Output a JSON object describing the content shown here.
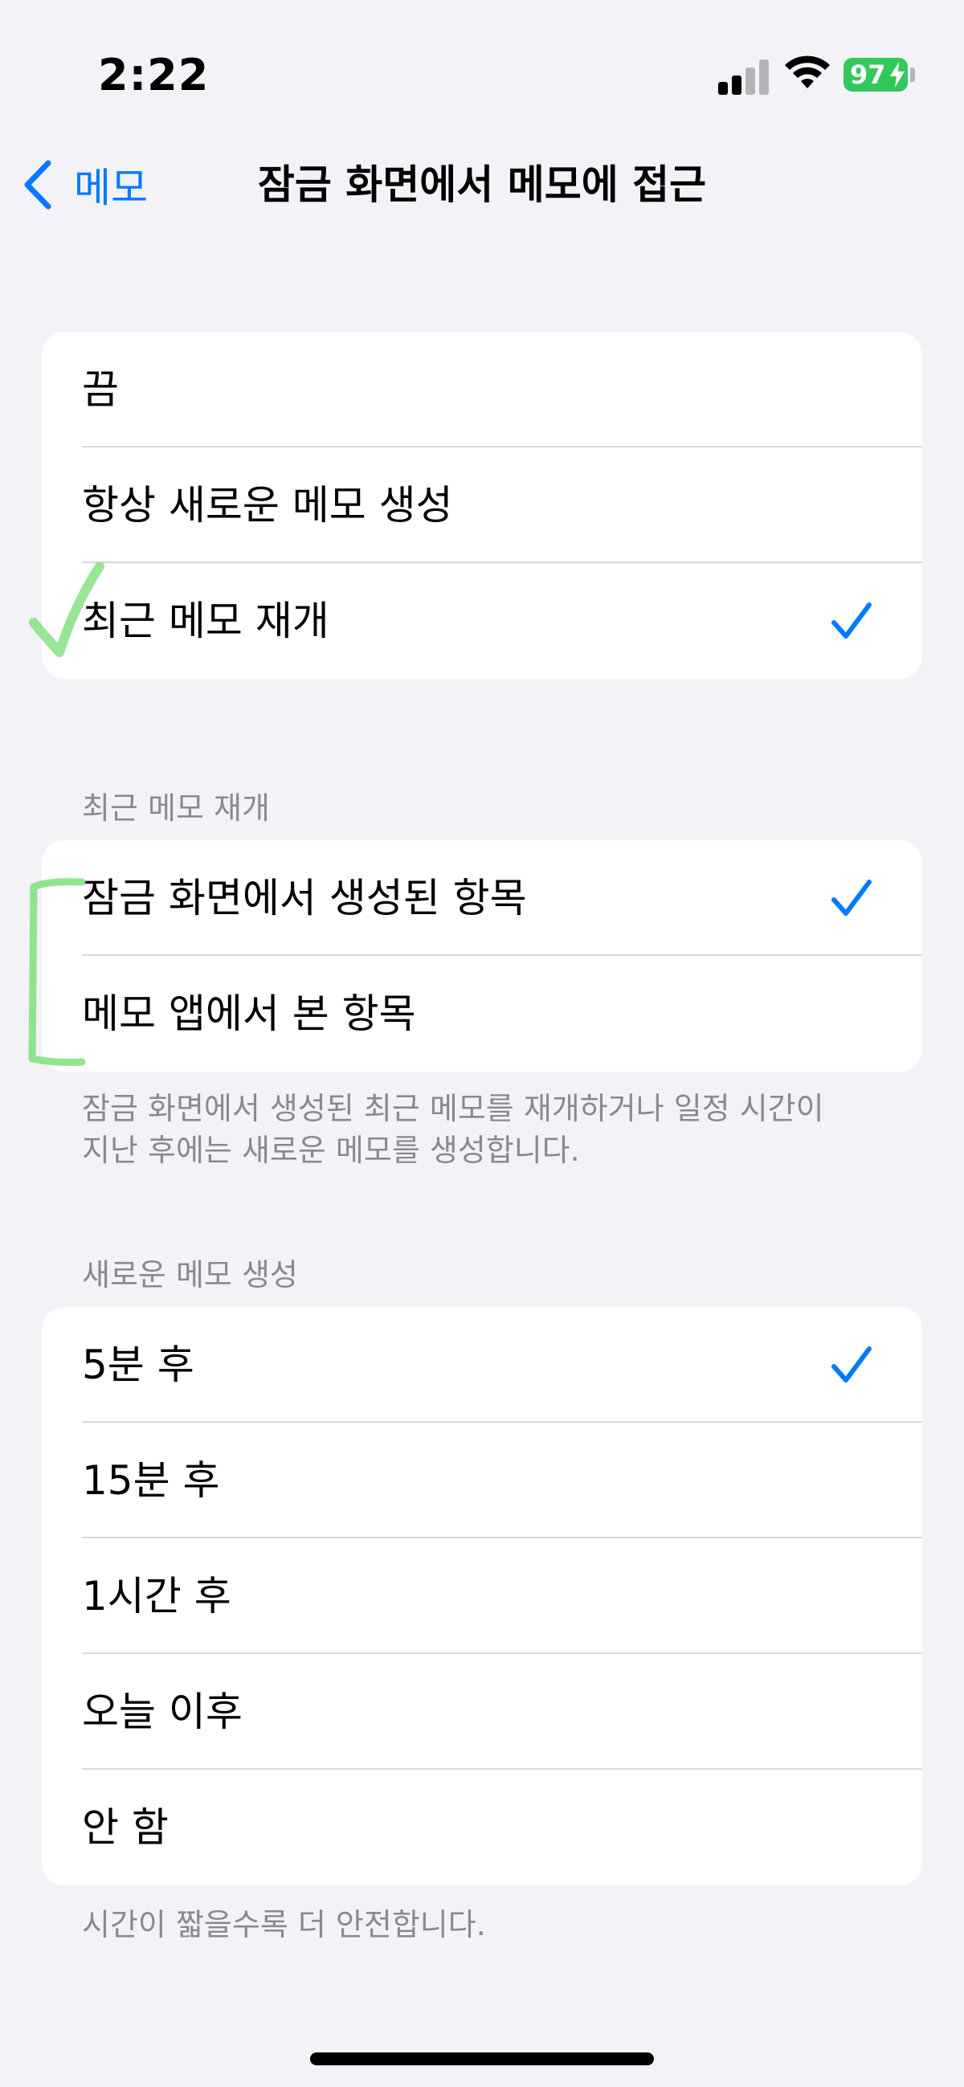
{
  "status_bar": {
    "time": "2:22",
    "battery_level": "97",
    "battery_color": "#34c759"
  },
  "nav": {
    "back_label": "메모",
    "title": "잠금 화면에서 메모에 접근"
  },
  "access_options": {
    "items": [
      {
        "label": "끔",
        "selected": false
      },
      {
        "label": "항상 새로운 메모 생성",
        "selected": false
      },
      {
        "label": "최근 메모 재개",
        "selected": true
      }
    ]
  },
  "resume_section": {
    "header": "최근 메모 재개",
    "items": [
      {
        "label": "잠금 화면에서 생성된 항목",
        "selected": true
      },
      {
        "label": "메모 앱에서 본 항목",
        "selected": false
      }
    ],
    "footer_line1": "잠금 화면에서 생성된 최근 메모를 재개하거나 일정 시간이",
    "footer_line2": "지난 후에는 새로운 메모를 생성합니다."
  },
  "new_note_section": {
    "header": "새로운 메모 생성",
    "items": [
      {
        "label": "5분 후",
        "selected": true
      },
      {
        "label": "15분 후",
        "selected": false
      },
      {
        "label": "1시간 후",
        "selected": false
      },
      {
        "label": "오늘 이후",
        "selected": false
      },
      {
        "label": "안 함",
        "selected": false
      }
    ],
    "footer": "시간이 짧을수록 더 안전합니다."
  },
  "colors": {
    "accent": "#007aff",
    "background": "#f2f2f7",
    "secondary_text": "#8a8a8e",
    "annotation_green": "#7ee07a"
  }
}
